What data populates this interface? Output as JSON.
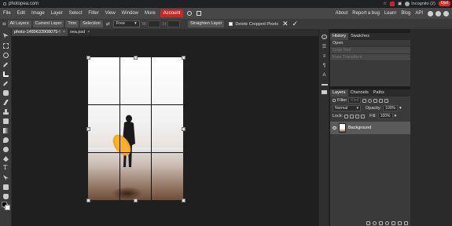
{
  "browser": {
    "url": "photopea.com",
    "incognito_label": "Incognito (2)",
    "update_label": "Upd"
  },
  "menu": {
    "items": [
      "File",
      "Edit",
      "Image",
      "Layer",
      "Select",
      "Filter",
      "View",
      "Window",
      "More"
    ],
    "account": "Account",
    "right_items": [
      "About",
      "Report a bug",
      "Learn",
      "Blog",
      "API"
    ],
    "social_icons": [
      "reddit-icon",
      "twitter-icon",
      "facebook-icon"
    ]
  },
  "options": {
    "buttons": [
      "All Layers",
      "Current Layer",
      "Trim",
      "Selection"
    ],
    "ratio_select": "Free",
    "w_label": "W",
    "h_label": "H",
    "straighten": "Straighten Layer",
    "delete_cropped": "Delete Cropped Pixels"
  },
  "doc_tabs": [
    {
      "label": "photo-1489633908075-!"
    },
    {
      "label": "sea.psd"
    }
  ],
  "history_panel": {
    "tabs": [
      "History",
      "Swatches"
    ],
    "rows": [
      "Open",
      "Crop Tool",
      "Free Transform"
    ]
  },
  "layers_panel": {
    "tabs": [
      "Layers",
      "Channels",
      "Paths"
    ],
    "filter_label": "Filter",
    "filter_kind": "Kind",
    "blend_mode": "Normal",
    "opacity_label": "Opacity:",
    "opacity_value": "100%",
    "lock_label": "Lock:",
    "fill_label": "Fill:",
    "fill_value": "100%",
    "layer_name": "Background"
  },
  "colors": {
    "account_red": "#c62828",
    "update_red": "#d93025"
  }
}
